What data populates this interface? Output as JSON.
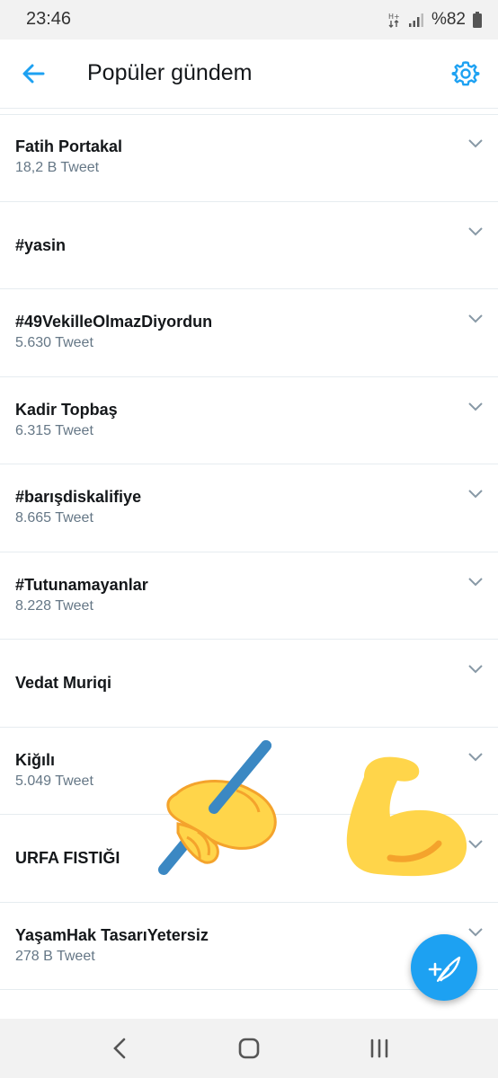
{
  "status_bar": {
    "time": "23:46",
    "battery": "%82"
  },
  "header": {
    "title": "Popüler gündem"
  },
  "trends": [
    {
      "name": "Fatih Portakal",
      "count": "18,2 B Tweet"
    },
    {
      "name": "#yasin",
      "count": ""
    },
    {
      "name": "#49VekilleOlmazDiyordun",
      "count": "5.630 Tweet"
    },
    {
      "name": "Kadir Topbaş",
      "count": "6.315 Tweet"
    },
    {
      "name": "#barışdiskalifiye",
      "count": "8.665 Tweet"
    },
    {
      "name": "#Tutunamayanlar",
      "count": "8.228 Tweet"
    },
    {
      "name": "Vedat Muriqi",
      "count": ""
    },
    {
      "name": "Kiğılı",
      "count": "5.049 Tweet"
    },
    {
      "name": "URFA FISTIĞI",
      "count": ""
    },
    {
      "name": "YaşamHak TasarıYetersiz",
      "count": "278 B Tweet"
    }
  ],
  "colors": {
    "accent": "#1da1f2",
    "emoji_yellow": "#ffd54a",
    "emoji_orange": "#f4a32c",
    "pen_blue": "#3b88c3"
  },
  "icons": {
    "back": "arrow-left-icon",
    "settings": "gear-icon",
    "chevron": "chevron-down-icon",
    "compose": "compose-tweet-icon"
  }
}
